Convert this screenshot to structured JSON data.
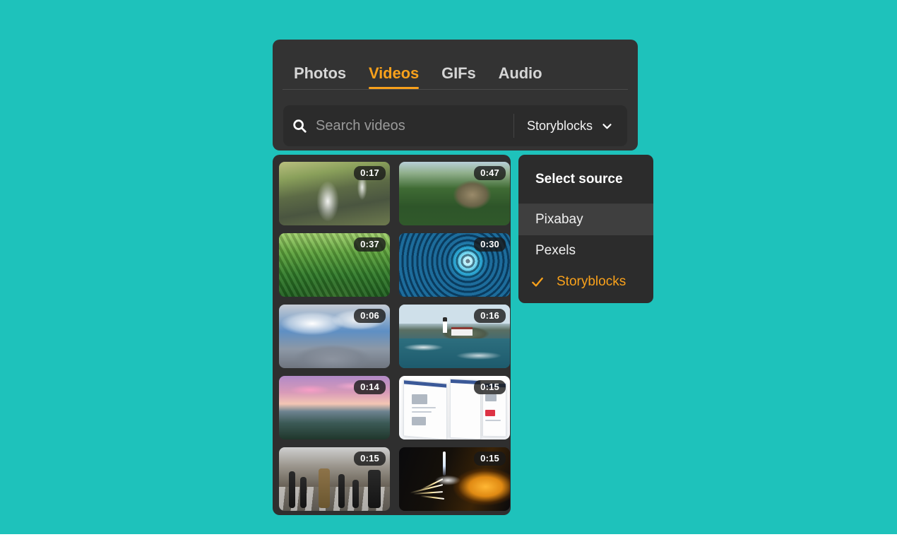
{
  "theme": {
    "page_background": "#1ec2bb",
    "panel_background": "#333333",
    "grid_background": "#2f2f2f",
    "menu_background": "#2c2c2c",
    "accent": "#f9a11b",
    "text_primary": "#f0f0f0",
    "text_muted": "#9a9a9a"
  },
  "tabs": [
    {
      "label": "Photos",
      "active": false
    },
    {
      "label": "Videos",
      "active": true
    },
    {
      "label": "GIFs",
      "active": false
    },
    {
      "label": "Audio",
      "active": false
    }
  ],
  "search": {
    "icon": "search-icon",
    "value": "",
    "placeholder": "Search videos",
    "source_label": "Storyblocks",
    "chevron_icon": "chevron-down-icon"
  },
  "grid": {
    "items": [
      {
        "duration": "0:17",
        "art": "art-waterfall",
        "alt": "aerial waterfall in green canyon"
      },
      {
        "duration": "0:47",
        "art": "art-forest-cliff",
        "alt": "aerial forest with rock cliff"
      },
      {
        "duration": "0:37",
        "art": "art-palms",
        "alt": "aerial palm plantation"
      },
      {
        "duration": "0:30",
        "art": "art-fish",
        "alt": "school of fish underwater vortex"
      },
      {
        "duration": "0:06",
        "art": "art-clouds",
        "alt": "clouds and blue sky timelapse"
      },
      {
        "duration": "0:16",
        "art": "art-lighthouse",
        "alt": "lighthouse on rocky coast"
      },
      {
        "duration": "0:14",
        "art": "art-pinksky",
        "alt": "pink sunset over misty mountains"
      },
      {
        "duration": "0:15",
        "art": "art-browser",
        "alt": "browser windows scrolling web pages"
      },
      {
        "duration": "0:15",
        "art": "art-crosswalk",
        "alt": "legs of pedestrians on crosswalk"
      },
      {
        "duration": "0:15",
        "art": "art-citylights",
        "alt": "night city light streaks with tower"
      }
    ]
  },
  "source_menu": {
    "title": "Select source",
    "items": [
      {
        "label": "Pixabay",
        "selected": false,
        "hovered": true
      },
      {
        "label": "Pexels",
        "selected": false,
        "hovered": false
      },
      {
        "label": "Storyblocks",
        "selected": true,
        "hovered": false
      }
    ],
    "check_icon": "check-icon"
  }
}
